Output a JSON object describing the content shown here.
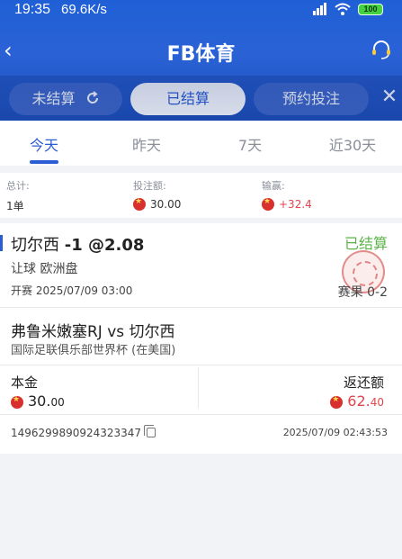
{
  "status_bar": {
    "time": "19:35",
    "speed": "69.6K/s",
    "battery": "100"
  },
  "header": {
    "title": "FB体育"
  },
  "filter_tabs": [
    {
      "label": "未结算"
    },
    {
      "label": "已结算"
    },
    {
      "label": "预约投注"
    }
  ],
  "date_tabs": [
    {
      "label": "今天"
    },
    {
      "label": "昨天"
    },
    {
      "label": "7天"
    },
    {
      "label": "近30天"
    }
  ],
  "summary": {
    "total_label": "总计:",
    "total_value": "1单",
    "stake_label": "投注额:",
    "stake_value": "30.00",
    "pnl_label": "输赢:",
    "pnl_value": "+32.4"
  },
  "bet": {
    "pick": "切尔西",
    "handicap": "-1 @2.08",
    "status": "已结算",
    "market": "让球 欧洲盘",
    "start_time": "开赛 2025/07/09 03:00",
    "score": "赛果 0-2",
    "match": "弗鲁米嫩塞RJ vs 切尔西",
    "league": "国际足联俱乐部世界杯 (在美国)",
    "principal_label": "本金",
    "principal_int": "30.",
    "principal_dec": "00",
    "return_label": "返还额",
    "return_int": "62.",
    "return_dec": "40",
    "order_id": "1496299890924323347",
    "order_time": "2025/07/09 02:43:53"
  },
  "colors": {
    "brand_blue": "#2a5cd4",
    "settled_green": "#5db24a",
    "profit_red": "#e0454d"
  }
}
